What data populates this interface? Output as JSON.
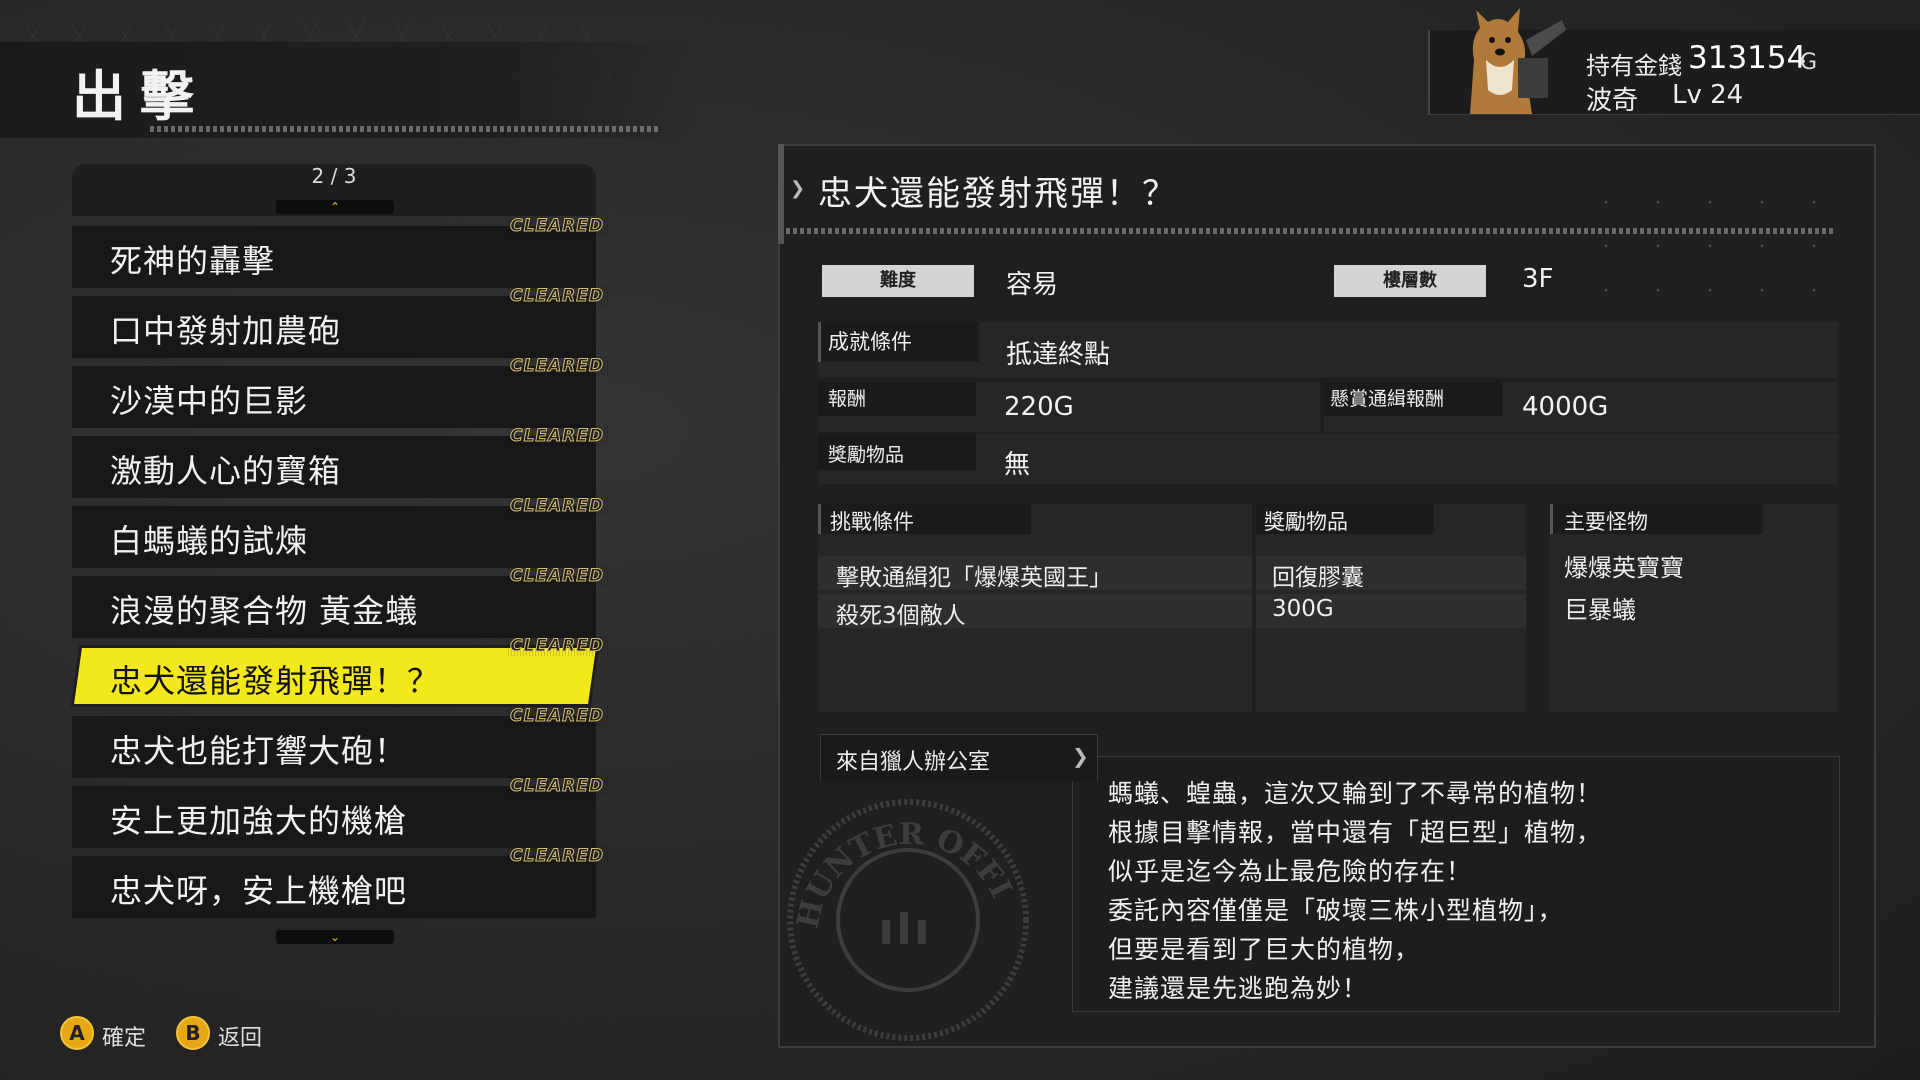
{
  "header": {
    "title": "出擊"
  },
  "player": {
    "money_label": "持有金錢",
    "money": "313154",
    "money_unit": "G",
    "name": "波奇",
    "level": "Lv 24"
  },
  "mission_list": {
    "page_indicator": "2 / 3",
    "cleared_label": "CLEARED",
    "items": [
      {
        "label": "死神的轟擊"
      },
      {
        "label": "口中發射加農砲"
      },
      {
        "label": "沙漠中的巨影"
      },
      {
        "label": "激動人心的寶箱"
      },
      {
        "label": "白螞蟻的試煉"
      },
      {
        "label": "浪漫的聚合物 黃金蟻"
      },
      {
        "label": "忠犬還能發射飛彈！？"
      },
      {
        "label": "忠犬也能打響大砲！"
      },
      {
        "label": "安上更加強大的機槍"
      },
      {
        "label": "忠犬呀，安上機槍吧"
      }
    ],
    "selected_index": 6
  },
  "detail": {
    "title": "忠犬還能發射飛彈！？",
    "difficulty_label": "難度",
    "difficulty": "容易",
    "floors_label": "樓層數",
    "floors": "3F",
    "achievement_label": "成就條件",
    "achievement": "抵達終點",
    "reward_label": "報酬",
    "reward": "220G",
    "bounty_label": "懸賞通緝報酬",
    "bounty": "4000G",
    "bonus_item_label": "獎勵物品",
    "bonus_item": "無",
    "challenge_header": "挑戰條件",
    "challenge_item_header": "獎勵物品",
    "monster_header": "主要怪物",
    "challenges": [
      {
        "condition": "擊敗通緝犯「爆爆英國王」",
        "reward": "回復膠囊"
      },
      {
        "condition": "殺死3個敵人",
        "reward": "300G"
      }
    ],
    "monsters": [
      "爆爆英寶寶",
      "巨暴蟻"
    ],
    "office_label": "來自獵人辦公室",
    "description": [
      "螞蟻、蝗蟲，這次又輪到了不尋常的植物！",
      "根據目擊情報，當中還有「超巨型」植物，",
      "似乎是迄今為止最危險的存在！",
      "委託內容僅僅是「破壞三株小型植物」，",
      "但要是看到了巨大的植物，",
      "建議還是先逃跑為妙！"
    ],
    "stamp_text": "HUNTER OFFICE"
  },
  "footer": {
    "confirm_key": "A",
    "confirm_label": "確定",
    "back_key": "B",
    "back_label": "返回"
  },
  "colors": {
    "accent": "#f3e81a",
    "button": "#e5a814"
  }
}
